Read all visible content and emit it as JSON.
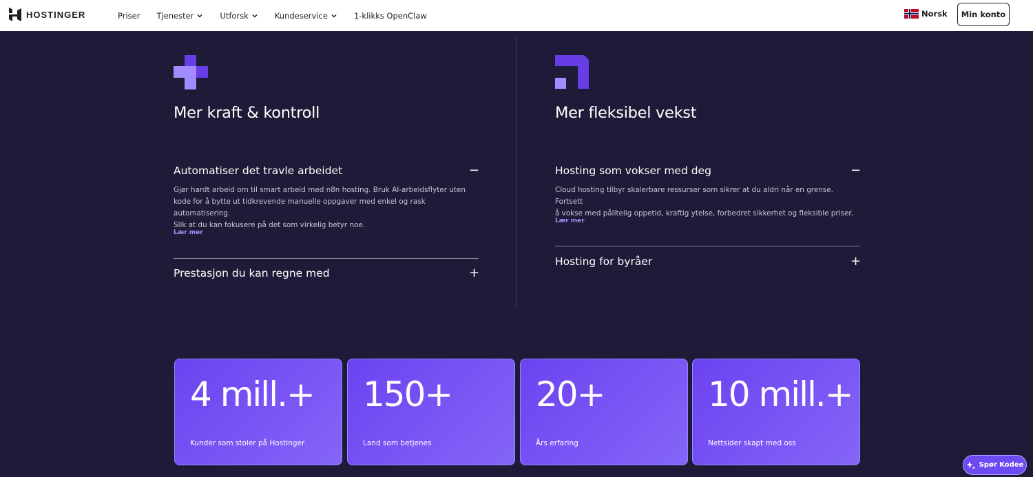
{
  "header": {
    "logo_text": "HOSTINGER",
    "nav": [
      {
        "label": "Priser",
        "has_chevron": false
      },
      {
        "label": "Tjenester",
        "has_chevron": true
      },
      {
        "label": "Utforsk",
        "has_chevron": true
      },
      {
        "label": "Kundeservice",
        "has_chevron": true
      },
      {
        "label": "1-klikks OpenClaw",
        "has_chevron": false
      }
    ],
    "language": "Norsk",
    "account_button": "Min konto"
  },
  "left_column": {
    "icon": "plus-blocks-icon",
    "title": "Mer kraft & kontroll",
    "accordion": [
      {
        "heading": "Automatiser det travle arbeidet",
        "toggle": "−",
        "expanded": true,
        "body_lines": [
          "Gjør hardt arbeid om til smart arbeid med n8n hosting. Bruk AI-arbeidsflyter uten",
          "kode for å bytte ut tidkrevende manuelle oppgaver med enkel og rask automatisering.",
          "Slik at du kan fokusere på det som virkelig betyr noe."
        ],
        "link": "Lær mer"
      },
      {
        "heading": "Prestasjon du kan regne med",
        "toggle": "+",
        "expanded": false
      }
    ]
  },
  "right_column": {
    "icon": "corner-blocks-icon",
    "title": "Mer fleksibel vekst",
    "accordion": [
      {
        "heading": "Hosting som vokser med deg",
        "toggle": "−",
        "expanded": true,
        "body_lines": [
          "Cloud hosting tilbyr skalerbare ressurser som sikrer at du aldri når en grense. Fortsett",
          "å vokse med pålitelig oppetid, kraftig ytelse, forbedret sikkerhet og fleksible priser."
        ],
        "link": "Lær mer"
      },
      {
        "heading": "Hosting for byråer",
        "toggle": "+",
        "expanded": false
      }
    ]
  },
  "stats": [
    {
      "value": "4 mill.+",
      "label": "Kunder som stoler på Hostinger"
    },
    {
      "value": "150+",
      "label": "Land som betjenes"
    },
    {
      "value": "20+",
      "label": "Års erfaring"
    },
    {
      "value": "10 mill.+",
      "label": "Nettsider skapt med oss"
    }
  ],
  "chat_button": "Spør Kodee",
  "colors": {
    "background": "#1d1b37",
    "accent": "#673de6",
    "link": "#a590ff"
  }
}
